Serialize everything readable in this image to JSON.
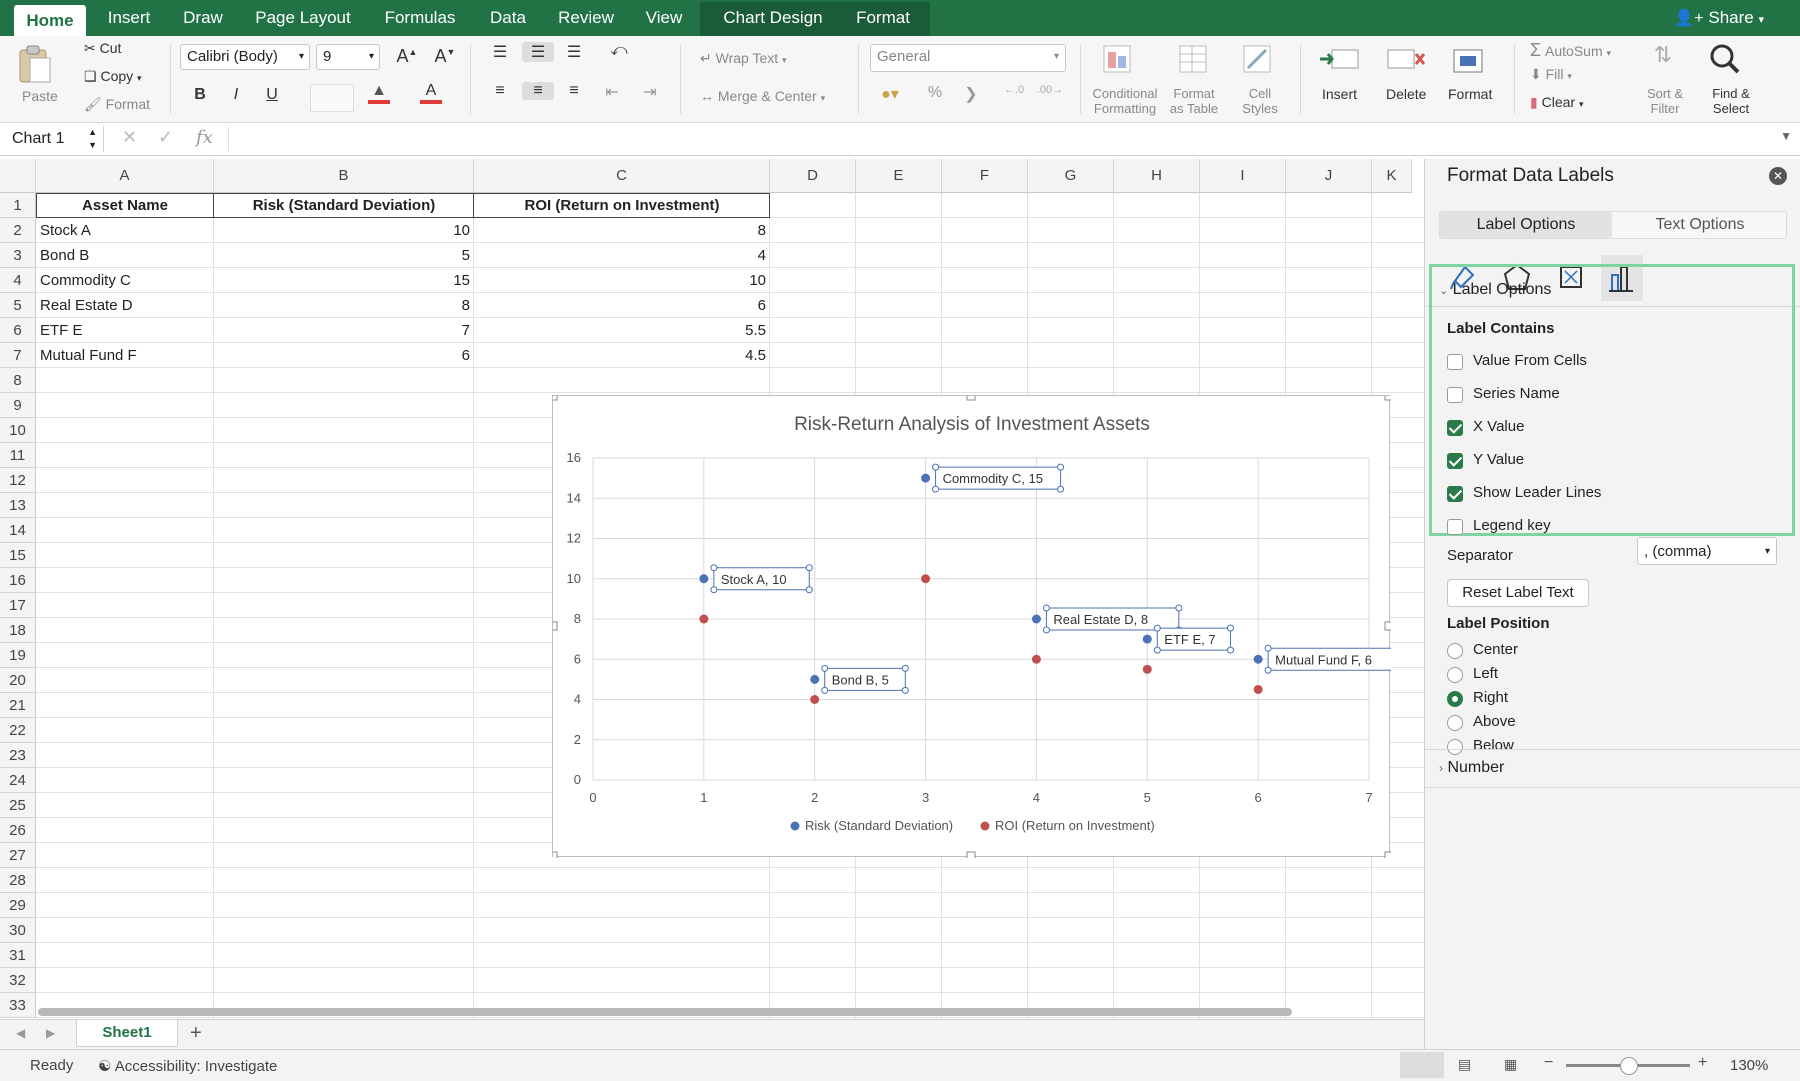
{
  "ribbon_tabs": [
    {
      "label": "Home",
      "active": true
    },
    {
      "label": "Insert"
    },
    {
      "label": "Draw"
    },
    {
      "label": "Page Layout"
    },
    {
      "label": "Formulas"
    },
    {
      "label": "Data"
    },
    {
      "label": "Review"
    },
    {
      "label": "View"
    },
    {
      "label": "Chart Design"
    },
    {
      "label": "Format"
    }
  ],
  "share_label": "Share",
  "ribbon": {
    "clipboard": {
      "paste": "Paste",
      "cut": "Cut",
      "copy": "Copy",
      "format": "Format"
    },
    "font_name": "Calibri (Body)",
    "font_size": "9",
    "bold": "B",
    "italic": "I",
    "underline": "U",
    "wrap_text": "Wrap Text",
    "merge_center": "Merge & Center",
    "number_format": "General",
    "percent": "%",
    "conditional_formatting": [
      "Conditional",
      "Formatting"
    ],
    "format_as_table": [
      "Format",
      "as Table"
    ],
    "cell_styles": [
      "Cell",
      "Styles"
    ],
    "insert": "Insert",
    "delete": "Delete",
    "format_cells": "Format",
    "autosum": "AutoSum",
    "fill": "Fill",
    "clear": "Clear",
    "sort_filter": [
      "Sort &",
      "Filter"
    ],
    "find_select": [
      "Find &",
      "Select"
    ]
  },
  "formula_bar": {
    "name_box": "Chart 1",
    "fx": "fx",
    "value": ""
  },
  "columns": [
    "A",
    "B",
    "C",
    "D",
    "E",
    "F",
    "G",
    "H",
    "I",
    "J",
    "K"
  ],
  "rows": [
    "1",
    "2",
    "3",
    "4",
    "5",
    "6",
    "7",
    "8",
    "9",
    "10",
    "11",
    "12",
    "13",
    "14",
    "15",
    "16",
    "17",
    "18",
    "19",
    "20",
    "21",
    "22",
    "23",
    "24",
    "25",
    "26",
    "27",
    "28",
    "29",
    "30",
    "31",
    "32",
    "33"
  ],
  "table": {
    "headers": [
      "Asset Name",
      "Risk (Standard Deviation)",
      "ROI (Return on Investment)"
    ],
    "rows": [
      [
        "Stock A",
        "10",
        "8"
      ],
      [
        "Bond B",
        "5",
        "4"
      ],
      [
        "Commodity C",
        "15",
        "10"
      ],
      [
        "Real Estate D",
        "8",
        "6"
      ],
      [
        "ETF E",
        "7",
        "5.5"
      ],
      [
        "Mutual Fund F",
        "6",
        "4.5"
      ]
    ]
  },
  "chart_data": {
    "type": "scatter",
    "title": "Risk-Return Analysis of Investment Assets",
    "xlim": [
      0,
      7
    ],
    "ylim": [
      0,
      16
    ],
    "x_ticks": [
      0,
      1,
      2,
      3,
      4,
      5,
      6,
      7
    ],
    "y_ticks": [
      0,
      2,
      4,
      6,
      8,
      10,
      12,
      14,
      16
    ],
    "grid": true,
    "legend_position": "bottom",
    "series": [
      {
        "name": "Risk (Standard Deviation)",
        "color": "#4a72b5",
        "points": [
          [
            1,
            10
          ],
          [
            2,
            5
          ],
          [
            3,
            15
          ],
          [
            4,
            8
          ],
          [
            5,
            7
          ],
          [
            6,
            6
          ]
        ],
        "labels": [
          "Stock A, 10",
          "Bond B, 5",
          "Commodity C, 15",
          "Real Estate D, 8",
          "ETF E, 7",
          "Mutual Fund F, 6"
        ]
      },
      {
        "name": "ROI (Return on Investment)",
        "color": "#c0504d",
        "points": [
          [
            1,
            8
          ],
          [
            2,
            4
          ],
          [
            3,
            10
          ],
          [
            4,
            6
          ],
          [
            5,
            5.5
          ],
          [
            6,
            4.5
          ]
        ]
      }
    ]
  },
  "panel": {
    "title": "Format Data Labels",
    "tabs": [
      "Label Options",
      "Text Options"
    ],
    "section_label_options": "Label Options",
    "label_contains": "Label Contains",
    "checkboxes": [
      {
        "label": "Value From Cells",
        "checked": false
      },
      {
        "label": "Series Name",
        "checked": false
      },
      {
        "label": "X Value",
        "checked": true
      },
      {
        "label": "Y Value",
        "checked": true
      },
      {
        "label": "Show Leader Lines",
        "checked": true
      },
      {
        "label": "Legend key",
        "checked": false
      }
    ],
    "separator_label": "Separator",
    "separator_value": ", (comma)",
    "reset_label": "Reset Label Text",
    "label_position": "Label Position",
    "positions": [
      {
        "label": "Center",
        "selected": false
      },
      {
        "label": "Left",
        "selected": false
      },
      {
        "label": "Right",
        "selected": true
      },
      {
        "label": "Above",
        "selected": false
      },
      {
        "label": "Below",
        "selected": false
      }
    ],
    "number_section": "Number"
  },
  "sheet_tab": "Sheet1",
  "status": {
    "ready": "Ready",
    "accessibility": "Accessibility: Investigate",
    "zoom": "130%"
  }
}
